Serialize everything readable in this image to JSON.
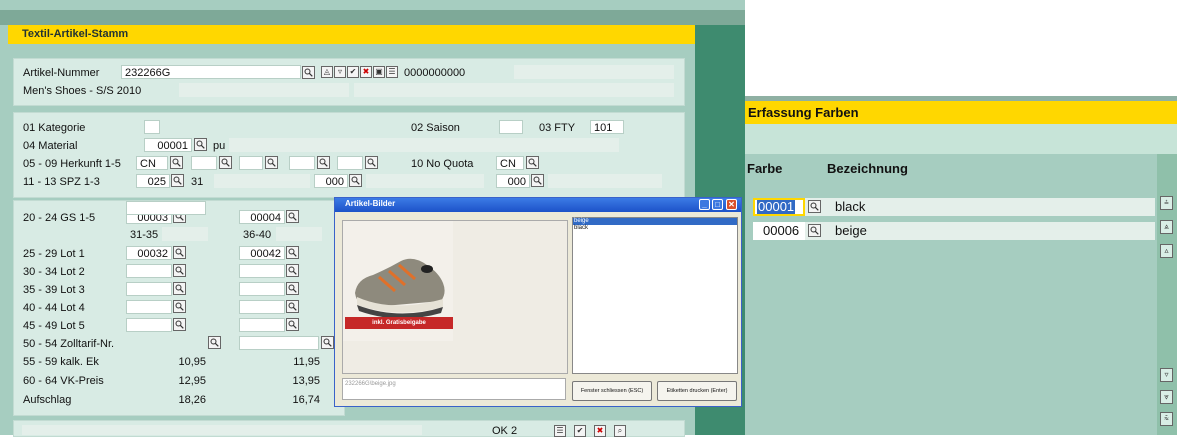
{
  "main": {
    "title": "Textil-Artikel-Stamm",
    "artikel_label": "Artikel-Nummer",
    "artikel_value": "232266G",
    "artikel_code": "0000000000",
    "artikel_desc": "Men's Shoes - S/S 2010",
    "kategorie_label": "01 Kategorie",
    "saison_label": "02 Saison",
    "fty_label": "03 FTY",
    "fty_value": "101",
    "material_label": "04 Material",
    "material_code": "00001",
    "material_text": "pu",
    "herkunft_label": "05 - 09 Herkunft 1-5",
    "herkunft_value": "CN",
    "noquota_label": "10 No Quota",
    "noquota_value": "CN",
    "spz_label": "11 - 13 SPZ 1-3",
    "spz1_code": "025",
    "spz1_text": "31",
    "spz2_code": "000",
    "spz3_code": "000",
    "gs_label": "20 - 24 GS 1-5",
    "gs1_code": "00003",
    "gs1_range": "31-35",
    "gs2_code": "00004",
    "gs2_range": "36-40",
    "lot1_label": "25 - 29 Lot 1",
    "lot1_code1": "00032",
    "lot1_code2": "00042",
    "lot2_label": "30 - 34 Lot 2",
    "lot3_label": "35 - 39 Lot 3",
    "lot4_label": "40 - 44 Lot 4",
    "lot5_label": "45 - 49 Lot 5",
    "zoll_label": "50 - 54 Zolltarif-Nr.",
    "kalk_label": "55 - 59 kalk. Ek",
    "kalk_v1": "10,95",
    "kalk_v2": "11,95",
    "vk_label": "60 - 64 VK-Preis",
    "vk_v1": "12,95",
    "vk_v2": "13,95",
    "aufschlag_label": "Aufschlag",
    "aufschlag_v1": "18,26",
    "aufschlag_v2": "16,74",
    "ok_label": "OK 2"
  },
  "dialog": {
    "title": "Artikel-Bilder",
    "banner": "inkl. Gratisbeigabe",
    "list_items": [
      "beige",
      "black"
    ],
    "path": "232266G\\beige.jpg",
    "close_button": "Fenster schliessen (ESC)",
    "print_button": "Etiketten drucken (Enter)"
  },
  "farben": {
    "title": "Erfassung Farben",
    "col_farbe": "Farbe",
    "col_bezeichnung": "Bezeichnung",
    "rows": [
      {
        "code": "00001",
        "name": "black"
      },
      {
        "code": "00006",
        "name": "beige"
      }
    ]
  },
  "colors": {
    "title_yellow": "#ffd700",
    "panel_green": "#a6cdc0",
    "dialog_blue": "#1d52c8",
    "banner_red": "#c62828"
  }
}
